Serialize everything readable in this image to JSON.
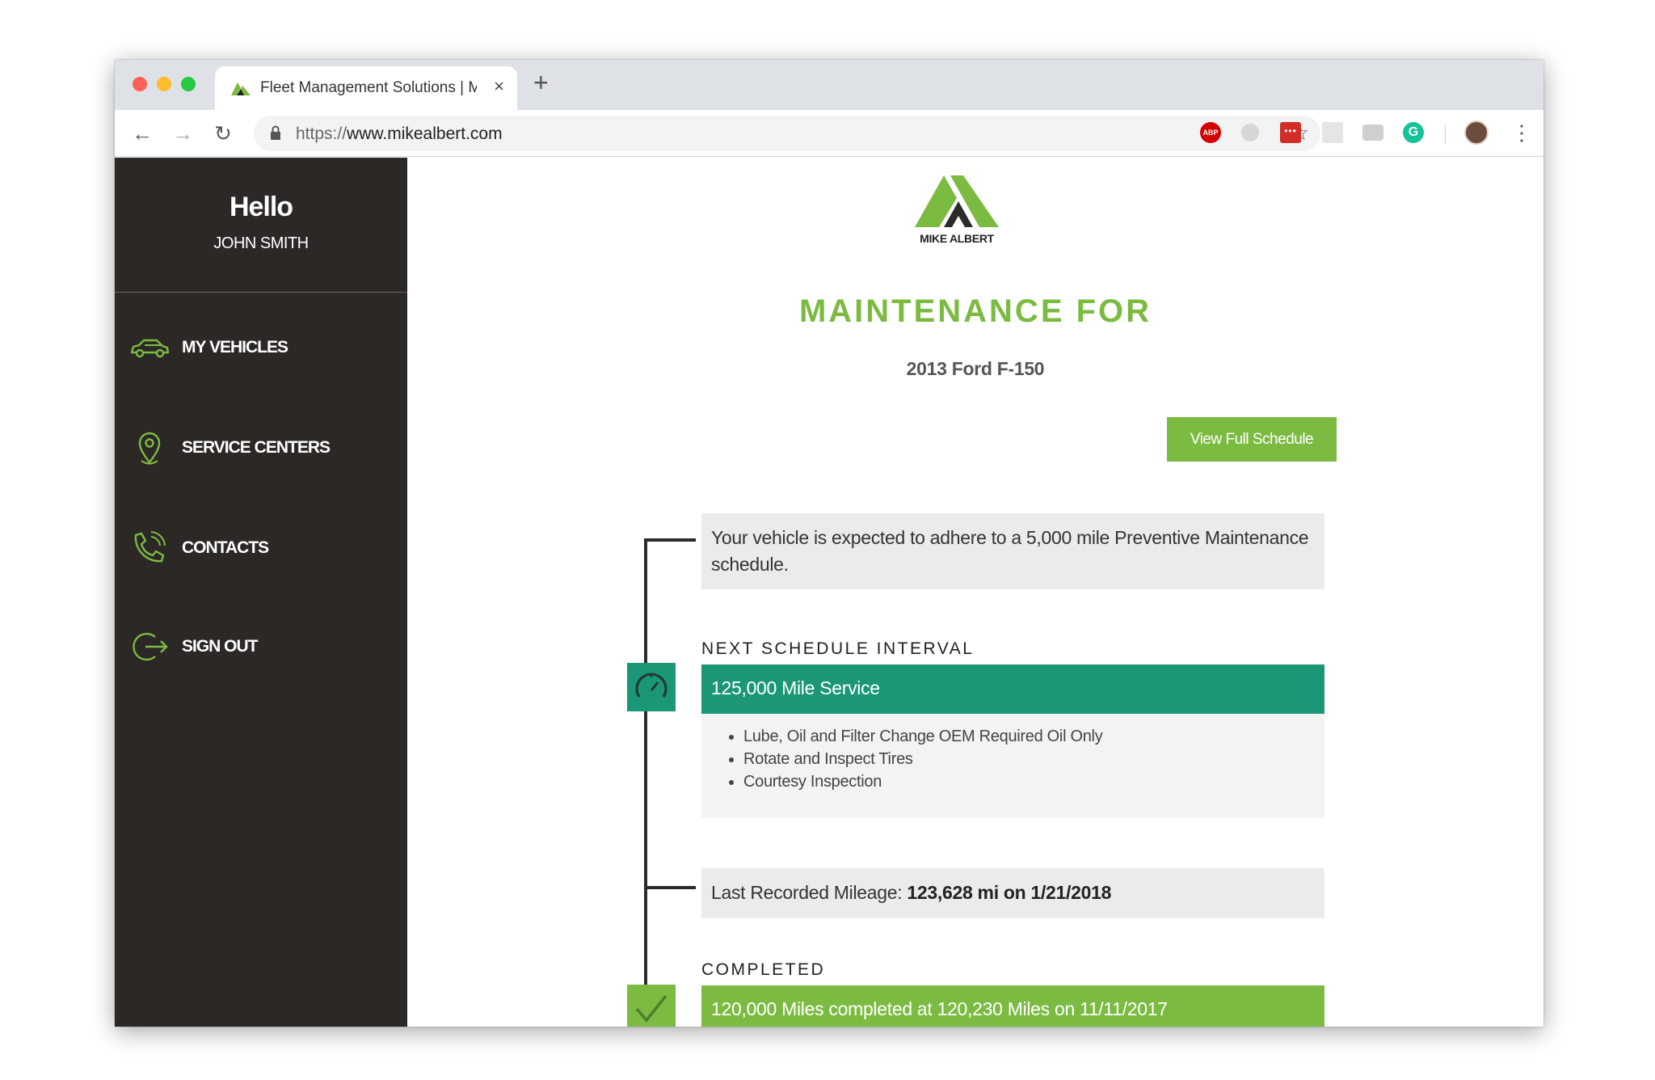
{
  "browser": {
    "tab_title": "Fleet Management Solutions | Mike Albert",
    "tab_close": "×",
    "new_tab": "+",
    "url_scheme": "https://",
    "url_host": "www.mikealbert.com",
    "extensions": {
      "abp": "ABP",
      "lastpass": "•••",
      "grammarly": "G"
    }
  },
  "sidebar": {
    "greeting": "Hello",
    "username": "JOHN SMITH",
    "items": [
      {
        "label": "MY VEHICLES",
        "icon": "car-icon"
      },
      {
        "label": "SERVICE CENTERS",
        "icon": "map-pin-icon"
      },
      {
        "label": "CONTACTS",
        "icon": "phone-icon"
      },
      {
        "label": "SIGN OUT",
        "icon": "sign-out-icon"
      }
    ]
  },
  "main": {
    "logo_text": "MIKE ALBERT",
    "heading": "MAINTENANCE FOR",
    "vehicle": "2013 Ford F-150",
    "view_schedule_button": "View Full Schedule",
    "intro_text": "Your vehicle is expected to adhere to a 5,000 mile Preventive Maintenance schedule.",
    "next_label": "NEXT SCHEDULE INTERVAL",
    "next_service": "125,000 Mile Service",
    "service_items": [
      "Lube, Oil and Filter Change OEM Required Oil Only",
      "Rotate and Inspect Tires",
      "Courtesy Inspection"
    ],
    "mileage_label": "Last Recorded Mileage:",
    "mileage_value": "123,628 mi on 1/21/2018",
    "completed_label": "COMPLETED",
    "completed_text": "120,000 Miles completed at 120,230 Miles on 11/11/2017"
  },
  "colors": {
    "brand_green": "#7cbb42",
    "teal": "#1b9677",
    "sidebar_bg": "#2c2826"
  }
}
